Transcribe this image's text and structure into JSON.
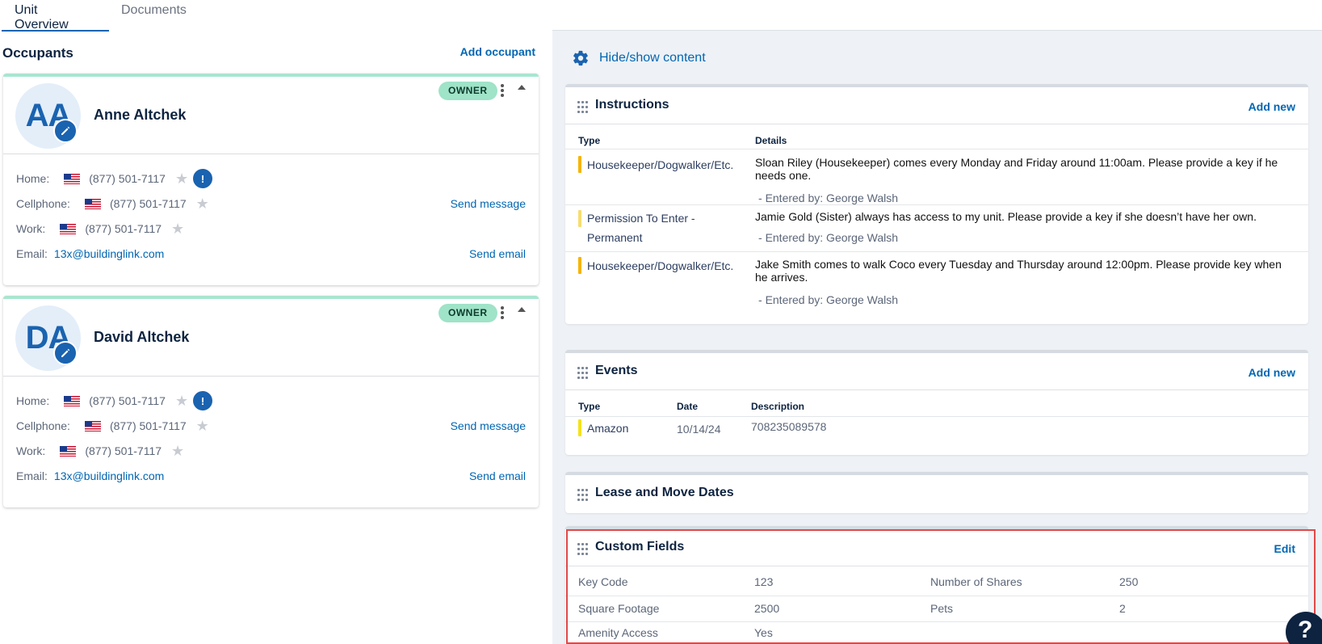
{
  "tabs": [
    {
      "label": "Unit Overview",
      "active": true
    },
    {
      "label": "Documents",
      "active": false
    }
  ],
  "occupants": {
    "title": "Occupants",
    "add_label": "Add occupant",
    "list": [
      {
        "initials": "AA",
        "name": "Anne Altchek",
        "badge": "OWNER",
        "home_label": "Home:",
        "home_phone": "(877) 501-7117",
        "cell_label": "Cellphone:",
        "cell_phone": "(877) 501-7117",
        "work_label": "Work:",
        "work_phone": "(877) 501-7117",
        "email_label": "Email:",
        "email": "13x@buildinglink.com",
        "send_message": "Send message",
        "send_email": "Send email"
      },
      {
        "initials": "DA",
        "name": "David Altchek",
        "badge": "OWNER",
        "home_label": "Home:",
        "home_phone": "(877) 501-7117",
        "cell_label": "Cellphone:",
        "cell_phone": "(877) 501-7117",
        "work_label": "Work:",
        "work_phone": "(877) 501-7117",
        "email_label": "Email:",
        "email": "13x@buildinglink.com",
        "send_message": "Send message",
        "send_email": "Send email"
      }
    ]
  },
  "hide_show_label": "Hide/show content",
  "instructions": {
    "title": "Instructions",
    "action": "Add new",
    "col_type": "Type",
    "col_details": "Details",
    "rows": [
      {
        "type": "Housekeeper/Dogwalker/Etc.",
        "details": "Sloan Riley (Housekeeper) comes every Monday and Friday around 11:00am. Please provide a key if he needs one.",
        "entered": "Entered by: George Walsh",
        "color": "#f5b400"
      },
      {
        "type": "Permission To Enter - Permanent",
        "details": "Jamie Gold (Sister) always has access to my unit. Please provide a key if she doesn’t have her own.",
        "entered": "Entered by: George Walsh",
        "color": "#f7dc6f"
      },
      {
        "type": "Housekeeper/Dogwalker/Etc.",
        "details": "Jake Smith comes to walk Coco every Tuesday and Thursday around 12:00pm. Please provide key when he arrives.",
        "entered": "Entered by: George Walsh",
        "color": "#f5b400"
      }
    ]
  },
  "events": {
    "title": "Events",
    "action": "Add new",
    "col_type": "Type",
    "col_date": "Date",
    "col_description": "Description",
    "rows": [
      {
        "type": "Amazon",
        "date": "10/14/24",
        "description": "708235089578",
        "color": "#f4e21a"
      }
    ]
  },
  "lease": {
    "title": "Lease and Move Dates"
  },
  "custom_fields": {
    "title": "Custom Fields",
    "action": "Edit",
    "rows": [
      {
        "k1": "Key Code",
        "v1": "123",
        "k2": "Number of Shares",
        "v2": "250"
      },
      {
        "k1": "Square Footage",
        "v1": "2500",
        "k2": "Pets",
        "v2": "2"
      },
      {
        "k1": "Amenity Access",
        "v1": "Yes",
        "k2": "",
        "v2": ""
      }
    ]
  },
  "help_label": "?"
}
